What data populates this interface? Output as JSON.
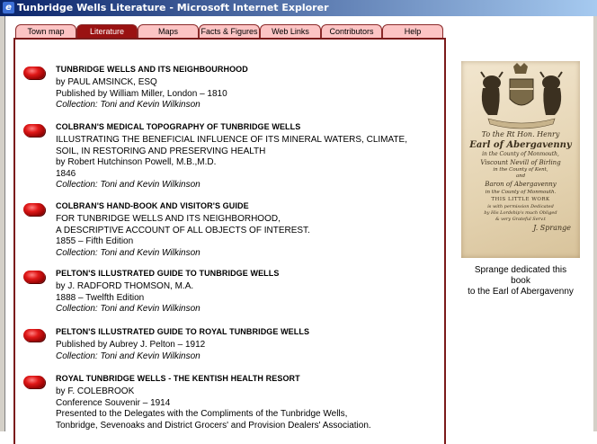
{
  "window": {
    "title": "Tunbridge Wells Literature - Microsoft Internet Explorer"
  },
  "nav": {
    "tabs": [
      {
        "label": "Town map"
      },
      {
        "label": "Literature",
        "active": true
      },
      {
        "label": "Maps"
      },
      {
        "label": "Facts & Figures"
      },
      {
        "label": "Web Links"
      },
      {
        "label": "Contributors"
      },
      {
        "label": "Help"
      }
    ]
  },
  "entries": [
    {
      "title": "TUNBRIDGE WELLS AND ITS NEIGHBOURHOOD",
      "lines": [
        "by PAUL AMSINCK, ESQ",
        "Published by William Miller, London – 1810"
      ],
      "collection": "Collection: Toni and Kevin Wilkinson"
    },
    {
      "title": "COLBRAN'S MEDICAL TOPOGRAPHY OF TUNBRIDGE WELLS",
      "lines": [
        "ILLUSTRATING THE BENEFICIAL INFLUENCE OF ITS MINERAL WATERS, CLIMATE,",
        "SOIL, IN RESTORING AND PRESERVING HEALTH",
        "by Robert Hutchinson Powell, M.B.,M.D.",
        "1846"
      ],
      "collection": "Collection: Toni and Kevin Wilkinson"
    },
    {
      "title": "COLBRAN'S HAND-BOOK AND VISITOR'S GUIDE",
      "lines": [
        "FOR TUNBRIDGE WELLS AND ITS NEIGHBORHOOD,",
        "A DESCRIPTIVE ACCOUNT OF ALL OBJECTS OF INTEREST.",
        "1855 – Fifth Edition"
      ],
      "collection": "Collection: Toni and Kevin Wilkinson"
    },
    {
      "title": "PELTON'S ILLUSTRATED GUIDE TO TUNBRIDGE WELLS",
      "lines": [
        "by J. RADFORD THOMSON, M.A.",
        "1888 – Twelfth Edition"
      ],
      "collection": "Collection: Toni and Kevin Wilkinson"
    },
    {
      "title": "PELTON'S ILLUSTRATED GUIDE TO ROYAL TUNBRIDGE WELLS",
      "lines": [
        "Published by Aubrey J. Pelton – 1912"
      ],
      "collection": "Collection: Toni and Kevin Wilkinson"
    },
    {
      "title": "ROYAL TUNBRIDGE WELLS - THE KENTISH HEALTH RESORT",
      "lines": [
        "by F. COLEBROOK",
        "Conference Souvenir – 1914",
        "Presented to the Delegates with the Compliments of the Tunbridge Wells,",
        "Tonbridge, Sevenoaks and District Grocers' and Provision Dealers' Association."
      ],
      "collection": ""
    }
  ],
  "sidebar": {
    "image": {
      "dedication": {
        "lines": [
          "To the Rt Hon. Henry",
          "Earl of Abergavenny",
          "in the County of Monmouth,",
          "Viscount Nevill of Birling",
          "in the County of Kent,",
          "and",
          "Baron of Abergavenny",
          "in the County of Monmouth.",
          "THIS LITTLE WORK",
          "is with permission Dedicated",
          "by His Lordship's much Obliged",
          "& very Grateful Serv.t",
          "J. Sprange"
        ]
      }
    },
    "caption_lines": [
      "Sprange dedicated this",
      "book",
      "to the Earl of Abergavenny"
    ]
  },
  "colors": {
    "tab_bg": "#fcc4c4",
    "tab_active": "#9a1212",
    "panel_border": "#7b1a1a",
    "bullet": "#e01818"
  }
}
